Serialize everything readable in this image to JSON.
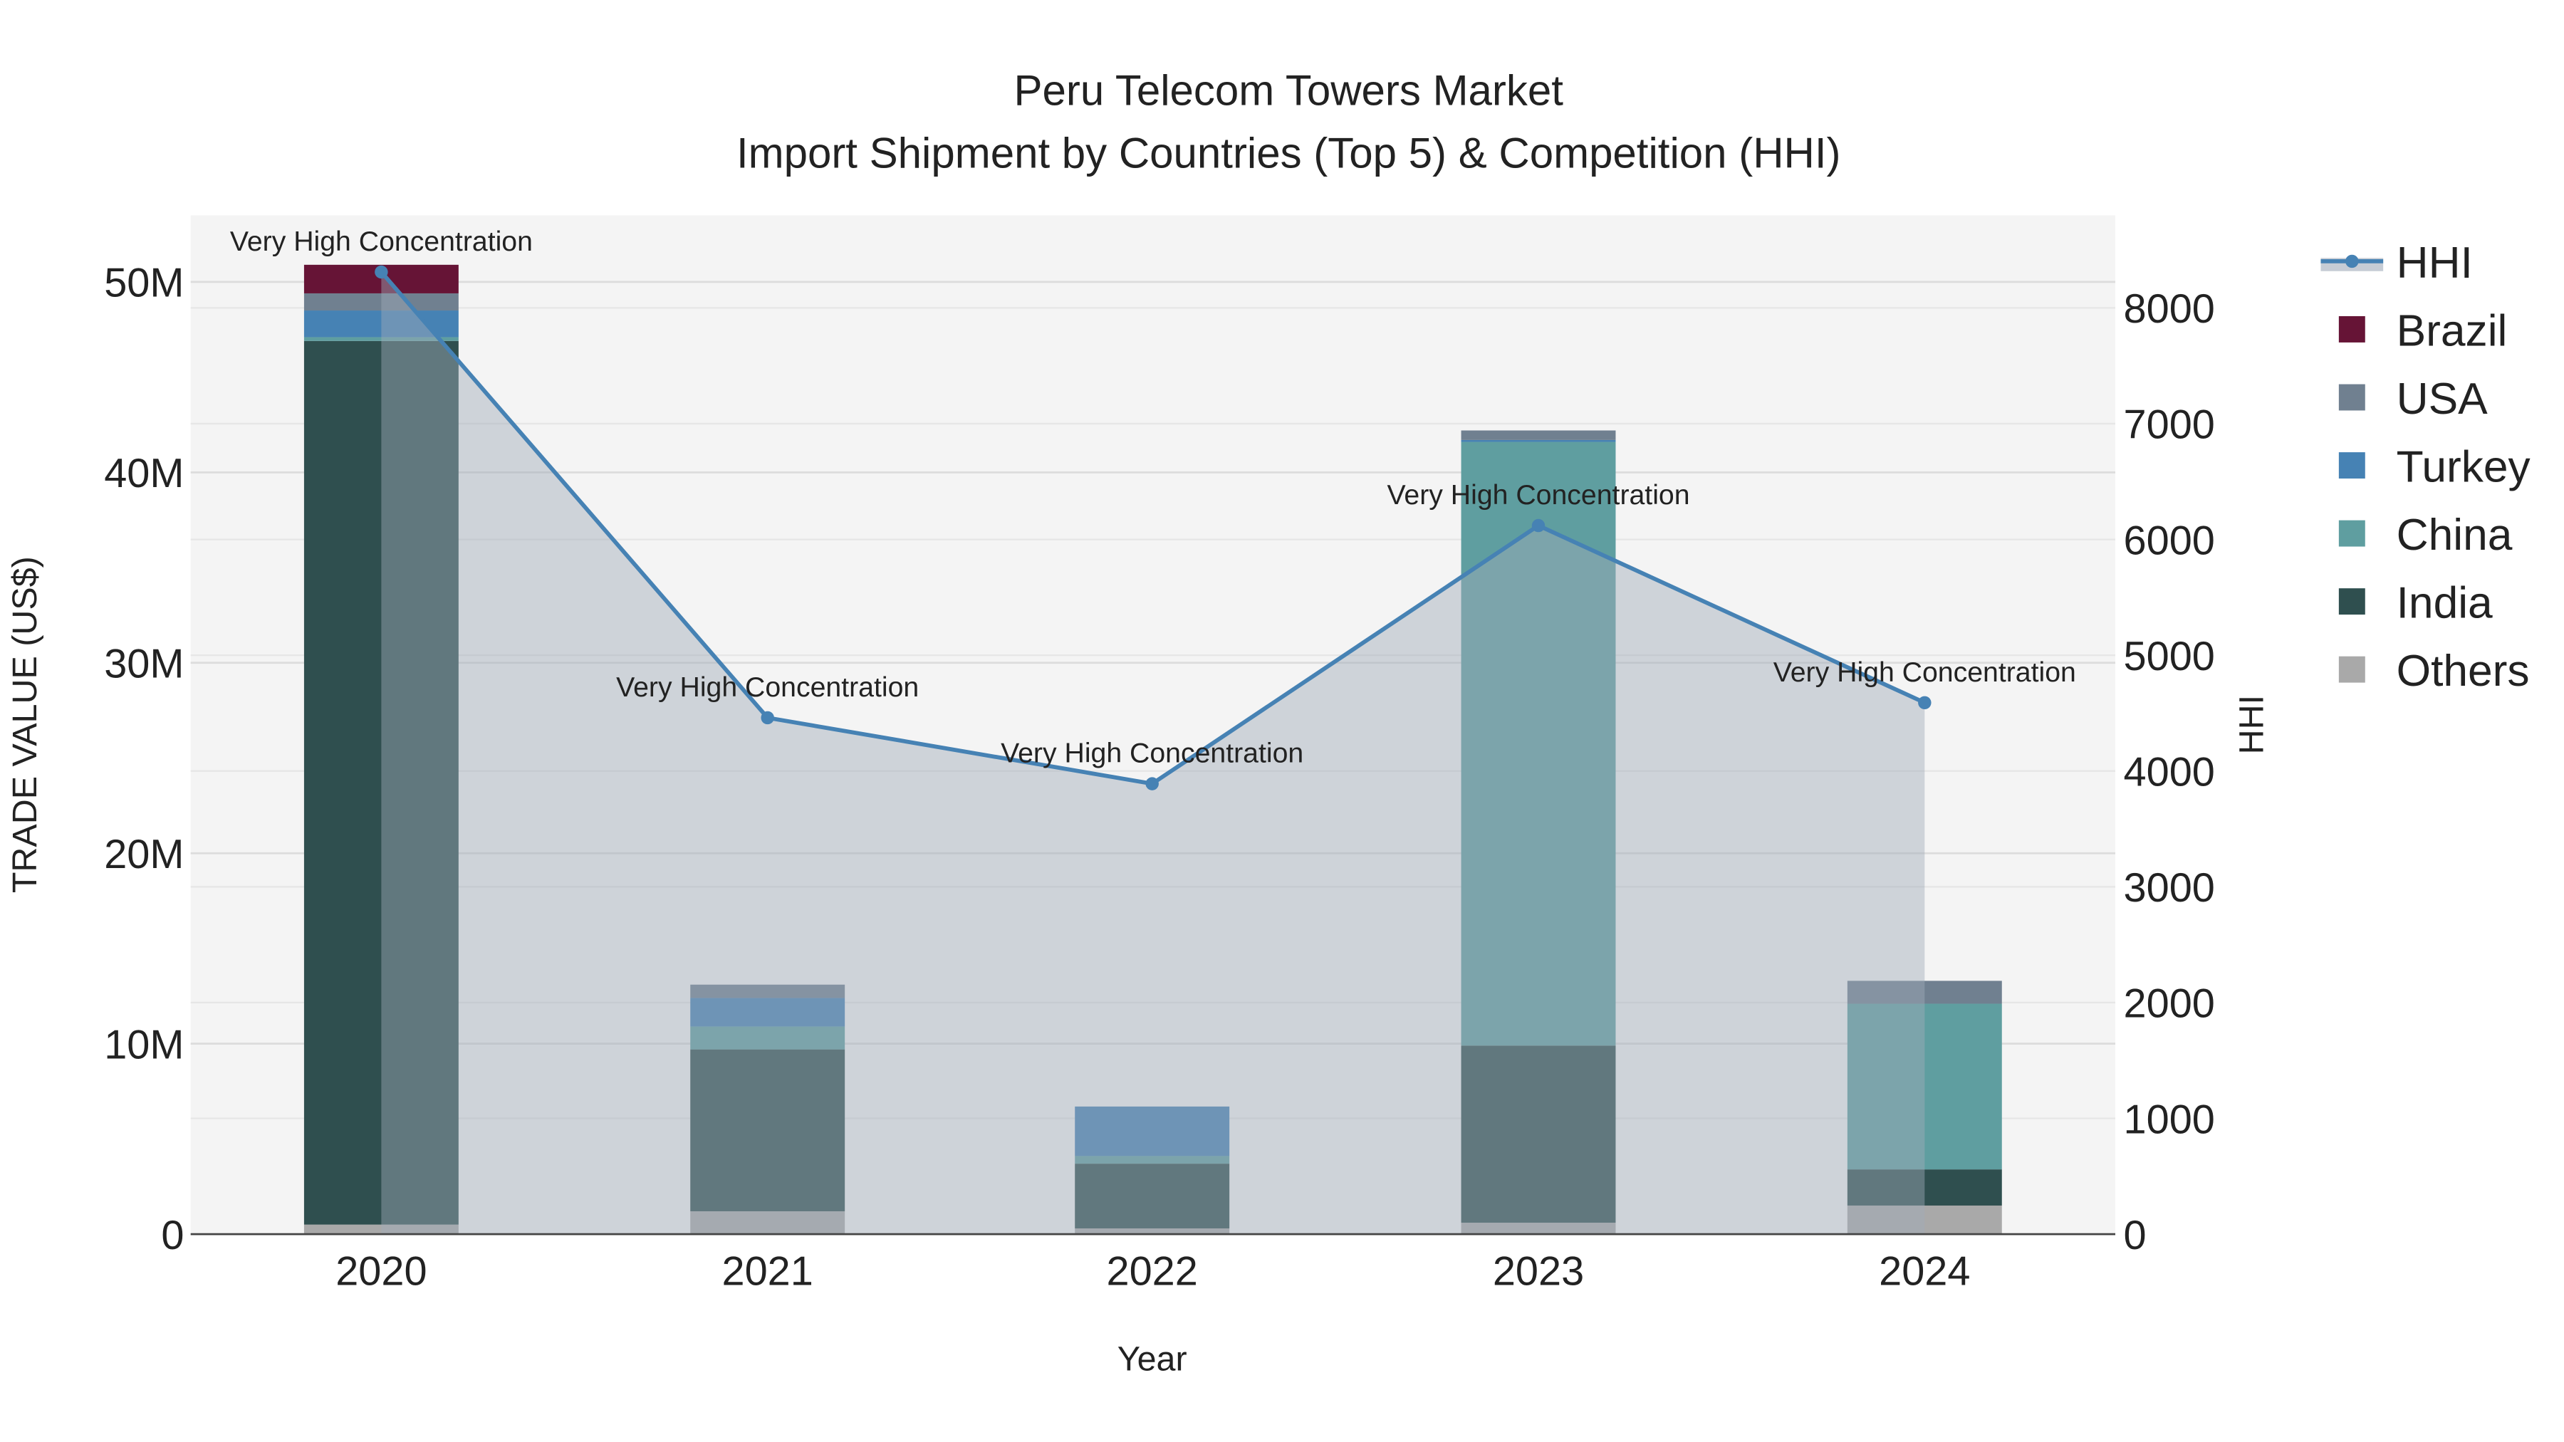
{
  "chart_data": {
    "type": "bar",
    "title": "Peru Telecom Towers Market",
    "subtitle": "Import Shipment by Countries (Top 5) & Competition (HHI)",
    "xlabel": "Year",
    "ylabel": "TRADE VALUE (US$)",
    "y2label": "HHI",
    "categories": [
      "2020",
      "2021",
      "2022",
      "2023",
      "2024"
    ],
    "ylim": [
      0,
      53500000
    ],
    "y2lim": [
      0,
      8800
    ],
    "yticks": [
      {
        "v": 0,
        "label": "0"
      },
      {
        "v": 10000000,
        "label": "10M"
      },
      {
        "v": 20000000,
        "label": "20M"
      },
      {
        "v": 30000000,
        "label": "30M"
      },
      {
        "v": 40000000,
        "label": "40M"
      },
      {
        "v": 50000000,
        "label": "50M"
      }
    ],
    "y2ticks": [
      {
        "v": 0,
        "label": "0"
      },
      {
        "v": 1000,
        "label": "1000"
      },
      {
        "v": 2000,
        "label": "2000"
      },
      {
        "v": 3000,
        "label": "3000"
      },
      {
        "v": 4000,
        "label": "4000"
      },
      {
        "v": 5000,
        "label": "5000"
      },
      {
        "v": 6000,
        "label": "6000"
      },
      {
        "v": 7000,
        "label": "7000"
      },
      {
        "v": 8000,
        "label": "8000"
      }
    ],
    "stacked_series": [
      {
        "name": "Others",
        "color": "#A9A9A9",
        "values": [
          500000,
          1200000,
          300000,
          600000,
          1500000
        ]
      },
      {
        "name": "India",
        "color": "#2F4F4F",
        "values": [
          46400000,
          8500000,
          3400000,
          9300000,
          1900000
        ]
      },
      {
        "name": "China",
        "color": "#5F9EA0",
        "values": [
          200000,
          1200000,
          400000,
          31700000,
          8700000
        ]
      },
      {
        "name": "Turkey",
        "color": "#4682B4",
        "values": [
          1400000,
          1500000,
          2600000,
          100000,
          0
        ]
      },
      {
        "name": "USA",
        "color": "#708090",
        "values": [
          900000,
          700000,
          0,
          500000,
          1200000
        ]
      },
      {
        "name": "Brazil",
        "color": "#661436",
        "values": [
          1500000,
          0,
          0,
          0,
          0
        ]
      }
    ],
    "line_series": {
      "name": "HHI",
      "color": "#4682B4",
      "values": [
        8310,
        4460,
        3890,
        6120,
        4590
      ]
    },
    "annotations": [
      "Very High Concentration",
      "Very High Concentration",
      "Very High Concentration",
      "Very High Concentration",
      "Very High Concentration"
    ],
    "legend": [
      "HHI",
      "Brazil",
      "USA",
      "Turkey",
      "China",
      "India",
      "Others"
    ],
    "legend_position": "right",
    "grid": true
  }
}
